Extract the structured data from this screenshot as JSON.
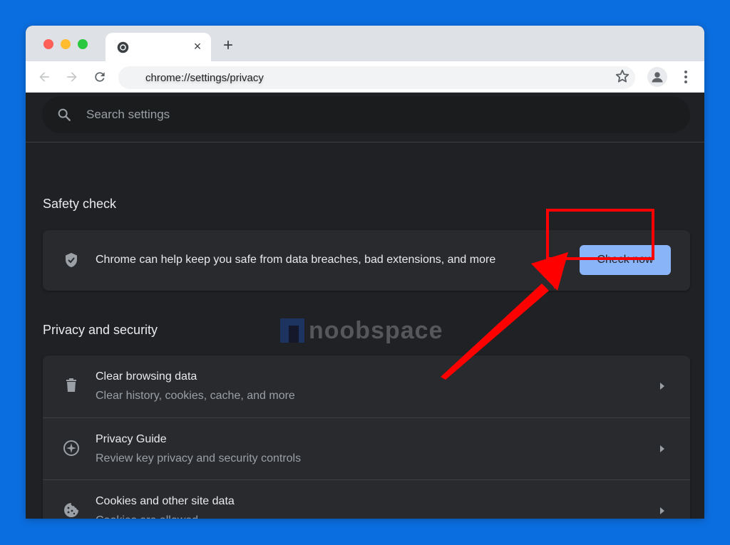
{
  "browser": {
    "tab": {
      "title": "",
      "favicon": "chrome-icon",
      "close_label": "×"
    },
    "new_tab_label": "+",
    "address": "chrome://settings/privacy",
    "icons": [
      "back-icon",
      "forward-icon",
      "reload-icon",
      "star-icon",
      "profile-icon",
      "kebab-menu-icon"
    ]
  },
  "search": {
    "placeholder": "Search settings",
    "value": ""
  },
  "safety_check": {
    "heading": "Safety check",
    "description": "Chrome can help keep you safe from data breaches, bad extensions, and more",
    "button_label": "Check now",
    "icon": "shield-check-icon"
  },
  "privacy": {
    "heading": "Privacy and security",
    "items": [
      {
        "title": "Clear browsing data",
        "subtitle": "Clear history, cookies, cache, and more",
        "icon": "trash-icon"
      },
      {
        "title": "Privacy Guide",
        "subtitle": "Review key privacy and security controls",
        "icon": "compass-icon"
      },
      {
        "title": "Cookies and other site data",
        "subtitle": "Cookies are allowed",
        "icon": "cookie-icon"
      }
    ]
  },
  "watermark": {
    "text": "noobspace"
  },
  "annotation": {
    "color": "#ff0000",
    "target": "Check now"
  },
  "colors": {
    "background": "#0b6ee0",
    "button": "#8ab4f8",
    "surface": "#292a2d",
    "page": "#202124"
  }
}
